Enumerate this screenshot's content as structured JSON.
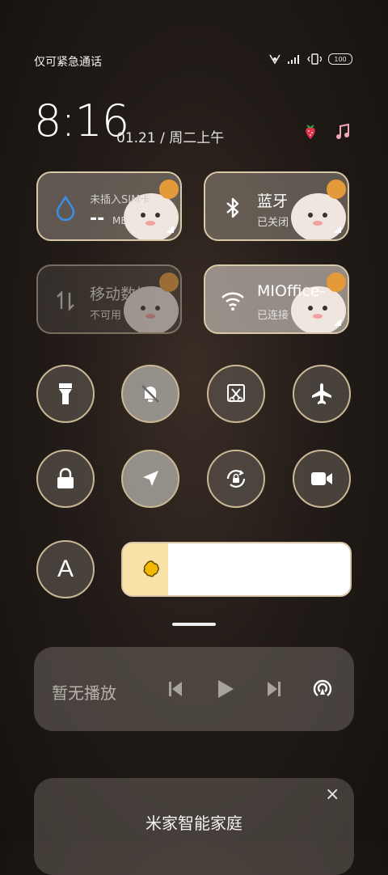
{
  "status_bar": {
    "carrier_text": "仅可紧急通话",
    "battery": "100",
    "icons": [
      "nfc-icon",
      "signal-icon",
      "vibrate-icon",
      "battery-icon"
    ]
  },
  "clock": {
    "time": "8:16",
    "date": "01.21 / 周二上午"
  },
  "top_icons": [
    "strawberry-icon",
    "music-note-icon"
  ],
  "tiles": {
    "data_usage": {
      "title": "未插入SIM卡",
      "value": "--",
      "unit": "MB",
      "icon": "water-drop-icon"
    },
    "bluetooth": {
      "title": "蓝牙",
      "status": "已关闭",
      "icon": "bluetooth-icon"
    },
    "mobile_data": {
      "title": "移动数据",
      "status": "不可用",
      "icon": "data-arrows-icon"
    },
    "wifi": {
      "title": "MIOffice-",
      "status": "已连接",
      "icon": "wifi-icon"
    }
  },
  "toggles_row1": [
    "flashlight-icon",
    "mute-bell-icon",
    "screenshot-icon",
    "airplane-icon"
  ],
  "toggles_row2": [
    "lock-icon",
    "location-icon",
    "rotation-lock-icon",
    "video-camera-icon"
  ],
  "auto_brightness": {
    "label": "A"
  },
  "brightness": {
    "level": 0.2,
    "icon": "sun-icon"
  },
  "media": {
    "text": "暂无播放",
    "controls": [
      "previous-icon",
      "play-icon",
      "next-icon",
      "cast-icon"
    ]
  },
  "smart_home": {
    "title": "米家智能家庭",
    "close": "×"
  },
  "colors": {
    "accent_blue": "#3a8eea",
    "slider_fill": "#f8e2a8",
    "tile_border": "#d8c7a8"
  }
}
